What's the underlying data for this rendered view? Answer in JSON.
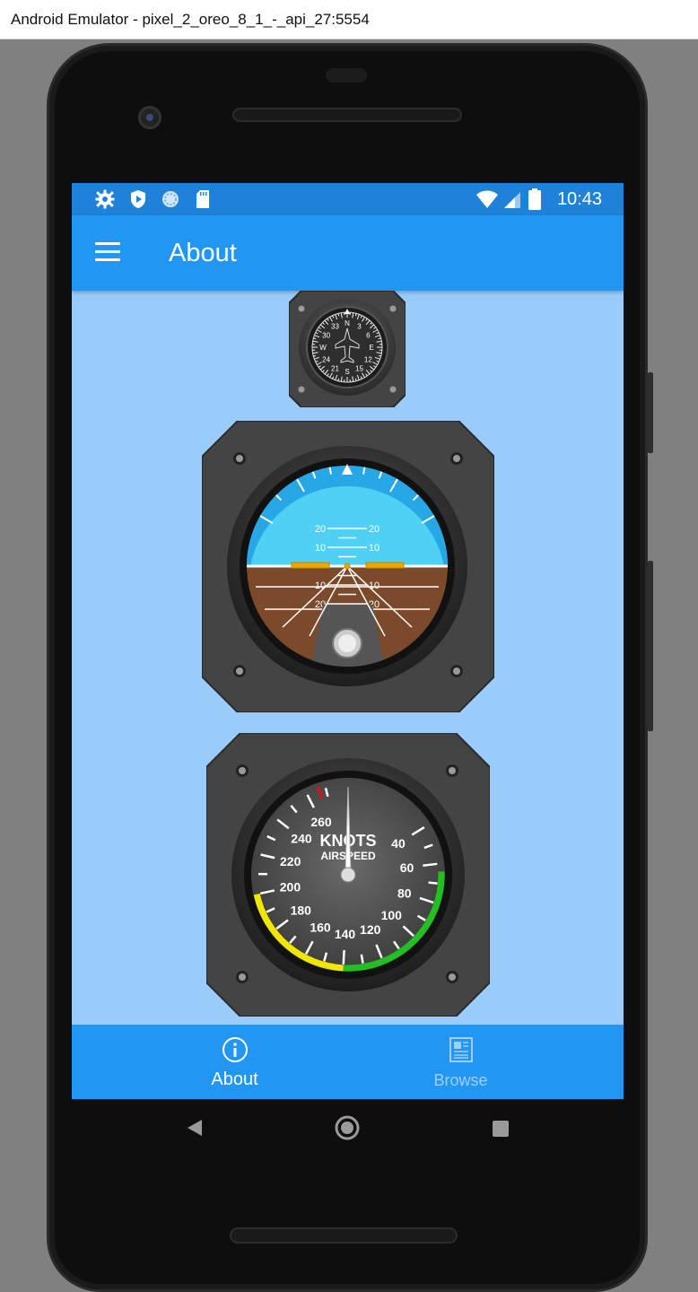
{
  "window": {
    "title": "Android Emulator - pixel_2_oreo_8_1_-_api_27:5554"
  },
  "statusbar": {
    "time": "10:43",
    "icons": [
      "settings-icon",
      "shield-play-icon",
      "sync-icon",
      "sd-card-icon",
      "wifi-icon",
      "signal-icon",
      "battery-icon"
    ]
  },
  "appbar": {
    "title": "About",
    "menu_icon": "hamburger-menu-icon"
  },
  "instruments": {
    "heading_indicator": {
      "cardinals": [
        "N",
        "3",
        "6",
        "E",
        "12",
        "15",
        "S",
        "21",
        "24",
        "W",
        "30",
        "33"
      ]
    },
    "attitude_indicator": {
      "pitch_up_labels": [
        "20",
        "10"
      ],
      "pitch_down_labels": [
        "10",
        "20"
      ],
      "sky_color": "#4fd0f5",
      "ground_color": "#7a4a2a"
    },
    "airspeed_indicator": {
      "title": "KNOTS",
      "subtitle": "AIRSPEED",
      "ticks": [
        "40",
        "60",
        "80",
        "100",
        "120",
        "140",
        "160",
        "180",
        "200",
        "220",
        "240",
        "260"
      ],
      "visible_ticks": [
        "260",
        "40",
        "240",
        "60",
        "220",
        "80",
        "200",
        "100",
        "180",
        "160",
        "140"
      ],
      "needle_value": 0
    }
  },
  "bottomnav": {
    "tabs": [
      {
        "label": "About",
        "icon": "info-icon",
        "active": true
      },
      {
        "label": "Browse",
        "icon": "newspaper-icon",
        "active": false
      }
    ]
  },
  "colors": {
    "primary": "#2196f3",
    "statusbar": "#1e82d8",
    "background": "#99ccfb"
  }
}
